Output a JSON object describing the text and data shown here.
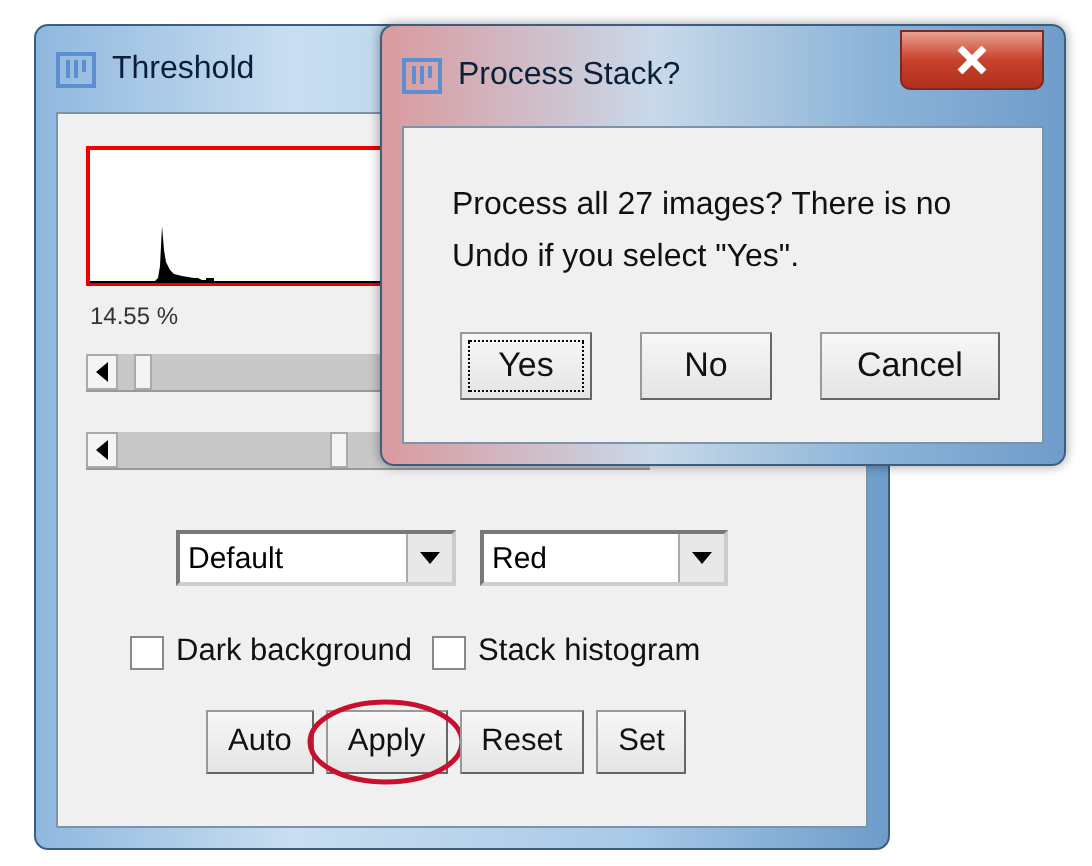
{
  "threshold_window": {
    "title": "Threshold",
    "percentage": "14.55 %",
    "sliders": [
      {
        "level": 0.03
      },
      {
        "level": 0.4
      }
    ],
    "dropdowns": [
      {
        "value": "Default"
      },
      {
        "value": "Red"
      }
    ],
    "checkboxes": [
      {
        "label": "Dark background",
        "checked": false
      },
      {
        "label": "Stack histogram",
        "checked": false
      }
    ],
    "buttons": [
      {
        "label": "Auto",
        "circled": false
      },
      {
        "label": "Apply",
        "circled": true
      },
      {
        "label": "Reset",
        "circled": false
      },
      {
        "label": "Set",
        "circled": false
      }
    ]
  },
  "dialog": {
    "title": "Process Stack?",
    "message": "Process all 27 images? There is no Undo if you select \"Yes\".",
    "buttons": [
      {
        "label": "Yes",
        "focused": true
      },
      {
        "label": "No",
        "focused": false
      },
      {
        "label": "Cancel",
        "focused": false
      }
    ]
  }
}
